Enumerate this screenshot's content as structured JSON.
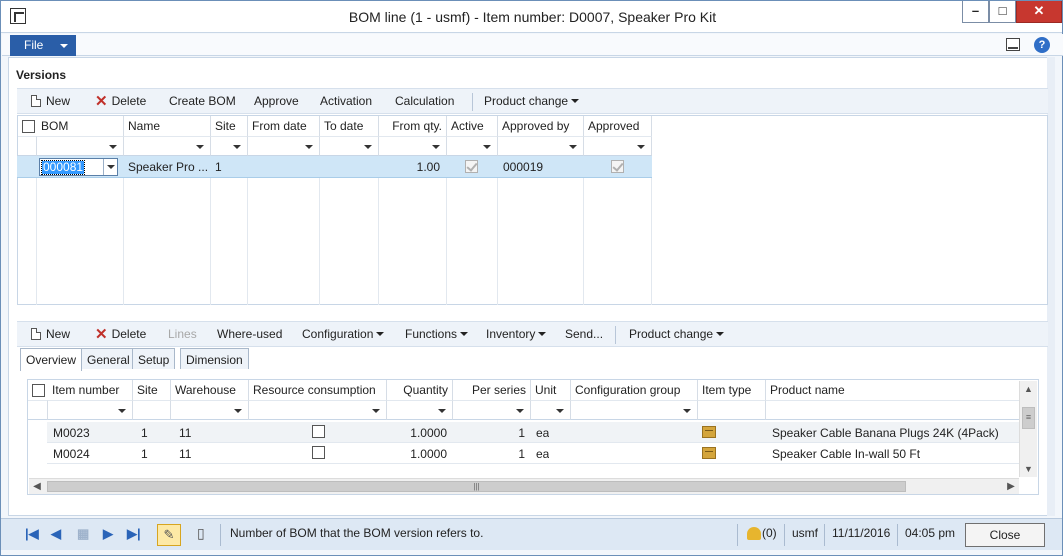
{
  "window": {
    "title": "BOM line (1 - usmf) - Item number: D0007, Speaker Pro Kit",
    "min": "–",
    "max": "□",
    "close": "✕"
  },
  "ribbon": {
    "file_label": "File",
    "help": "?"
  },
  "versions": {
    "section_title": "Versions",
    "toolbar": {
      "new": "New",
      "delete": "Delete",
      "create_bom": "Create BOM",
      "approve": "Approve",
      "activation": "Activation",
      "calculation": "Calculation",
      "product_change": "Product change"
    },
    "columns": [
      "BOM",
      "Name",
      "Site",
      "From date",
      "To date",
      "From qty.",
      "Active",
      "Approved by",
      "Approved"
    ],
    "row": {
      "bom": "000081",
      "name": "Speaker Pro ...",
      "site": "1",
      "from_date": "",
      "to_date": "",
      "from_qty": "1.00",
      "active": true,
      "approved_by": "000019",
      "approved": true
    }
  },
  "lines": {
    "toolbar": {
      "new": "New",
      "delete": "Delete",
      "lines": "Lines",
      "where_used": "Where-used",
      "configuration": "Configuration",
      "functions": "Functions",
      "inventory": "Inventory",
      "send": "Send...",
      "product_change": "Product change"
    },
    "tabs": [
      "Overview",
      "General",
      "Setup",
      "Dimension"
    ],
    "columns": [
      "Item number",
      "Site",
      "Warehouse",
      "Resource consumption",
      "Quantity",
      "Per series",
      "Unit",
      "Configuration group",
      "Item type",
      "Product name"
    ],
    "rows": [
      {
        "item_number": "M0023",
        "site": "1",
        "warehouse": "11",
        "resource_consumption": false,
        "quantity": "1.0000",
        "per_series": "1",
        "unit": "ea",
        "configuration_group": "",
        "item_type_icon": "box-icon",
        "product_name": "Speaker Cable Banana Plugs 24K (4Pack)"
      },
      {
        "item_number": "M0024",
        "site": "1",
        "warehouse": "11",
        "resource_consumption": false,
        "quantity": "1.0000",
        "per_series": "1",
        "unit": "ea",
        "configuration_group": "",
        "item_type_icon": "box-icon",
        "product_name": "Speaker Cable In-wall 50 Ft"
      }
    ]
  },
  "statusbar": {
    "help_text": "Number of BOM that the BOM version refers to.",
    "notifications": "(0)",
    "company": "usmf",
    "date": "11/11/2016",
    "time": "04:05 pm",
    "close_label": "Close"
  },
  "colors": {
    "accent": "#2a5ea8",
    "selected_row": "#cfe6f7",
    "close_window": "#c7372f"
  }
}
